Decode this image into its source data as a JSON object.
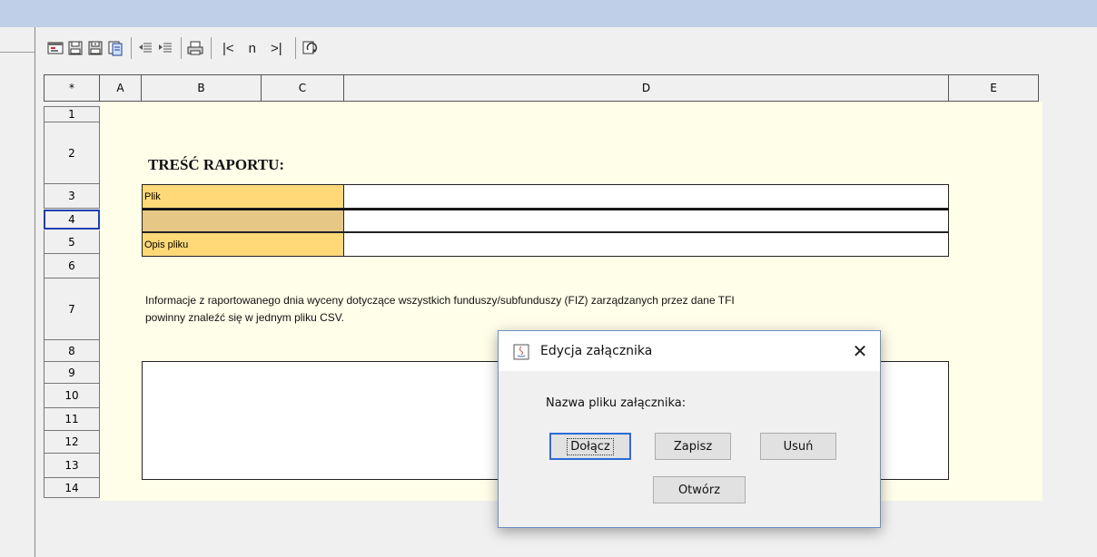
{
  "toolbar": {
    "items": [
      {
        "icon": "select-icon"
      },
      {
        "icon": "save-icon"
      },
      {
        "icon": "save-as-icon"
      },
      {
        "icon": "copy-icon"
      },
      {
        "icon": "outdent-icon"
      },
      {
        "icon": "indent-icon"
      },
      {
        "icon": "print-icon"
      }
    ],
    "nav_first": "|<",
    "nav_n": "n",
    "nav_last": ">|",
    "refresh_icon": "refresh-icon"
  },
  "grid": {
    "corner": "*",
    "columns": [
      "A",
      "B",
      "C",
      "D",
      "E"
    ],
    "rows": [
      "1",
      "2",
      "3",
      "4",
      "5",
      "6",
      "7",
      "8",
      "9",
      "10",
      "11",
      "12",
      "13",
      "14"
    ]
  },
  "sheet": {
    "title": "TREŚĆ RAPORTU:",
    "plik_label": "Plik",
    "plik_value": "",
    "row4_label": "",
    "opis_label": "Opis pliku",
    "opis_value": "",
    "info_line1": "Informacje z raportowanego dnia wyceny dotyczące wszystkich funduszy/subfunduszy (FIZ) zarządzanych przez dane TFI",
    "info_line2": "powinny znaleźć się w jednym pliku CSV."
  },
  "dialog": {
    "title": "Edycja załącznika",
    "close": "✕",
    "label": "Nazwa pliku załącznika:",
    "btn_attach": "Dołącz",
    "btn_save": "Zapisz",
    "btn_delete": "Usuń",
    "btn_open": "Otwórz"
  },
  "colors": {
    "sheet_bg": "#fffee9",
    "label_cell": "#ffd978",
    "selected_row_header": "#1f3fb0",
    "dialog_border": "#6a8fc4"
  }
}
